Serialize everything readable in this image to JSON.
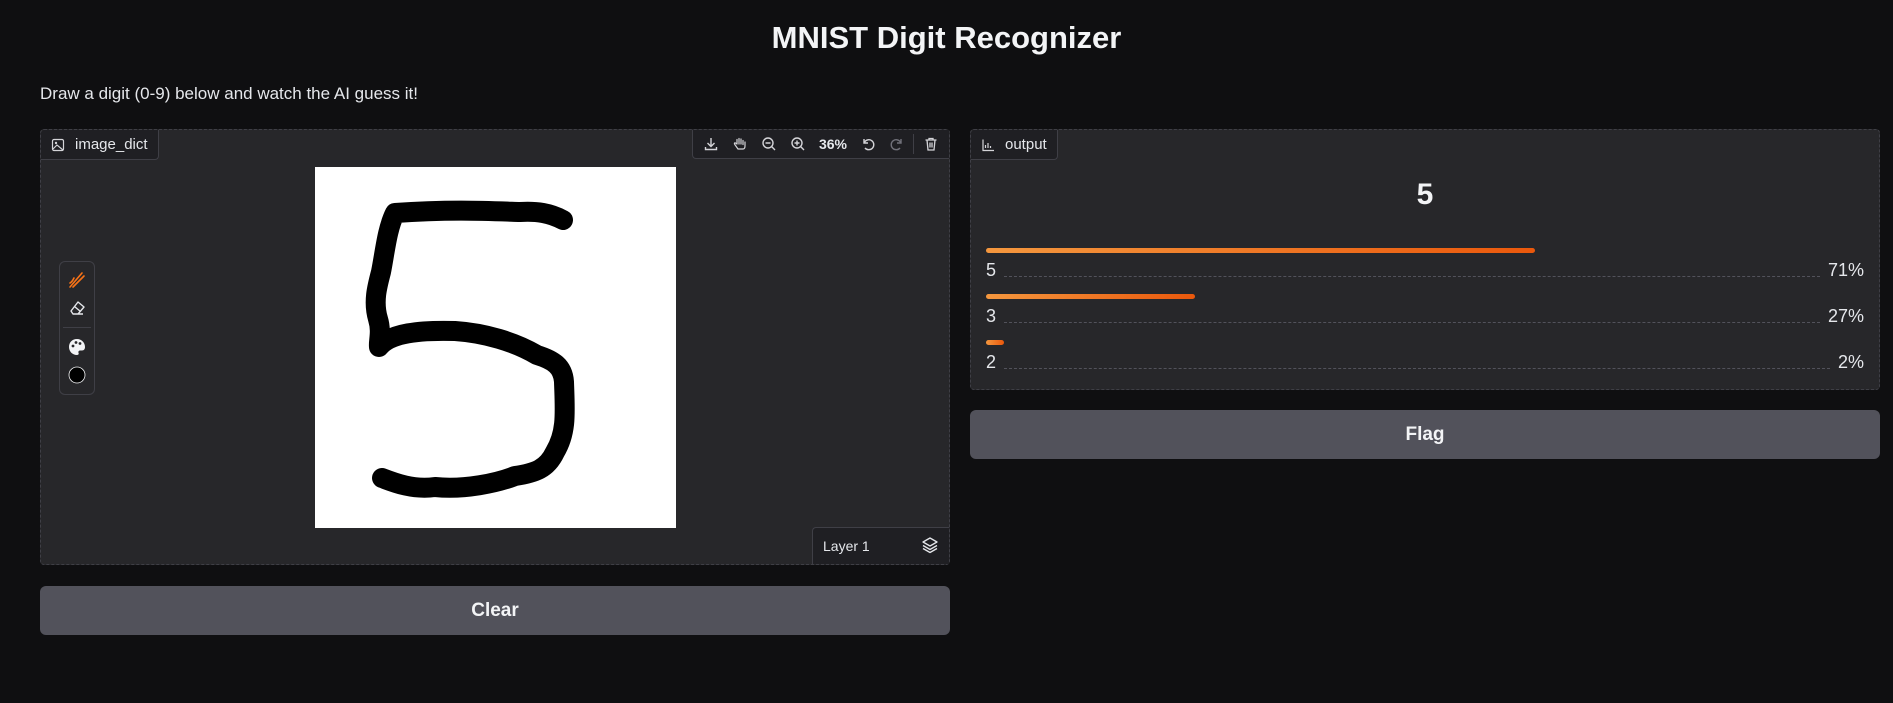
{
  "app": {
    "title": "MNIST Digit Recognizer",
    "description": "Draw a digit (0-9) below and watch the AI guess it!"
  },
  "input_panel": {
    "label": "image_dict",
    "zoom": "36%",
    "toolbar_icons": [
      "download-icon",
      "pan-hand-icon",
      "zoom-out-icon",
      "zoom-in-icon",
      "undo-icon",
      "redo-icon",
      "trash-icon"
    ],
    "tools": [
      "brush-icon",
      "eraser-icon",
      "palette-icon",
      "brush-size-icon"
    ],
    "layer_label": "Layer 1",
    "accent_color": "#f97316"
  },
  "output_panel": {
    "label": "output",
    "prediction": "5",
    "confidences": [
      {
        "label": "5",
        "value": "71%",
        "fraction": 0.71
      },
      {
        "label": "3",
        "value": "27%",
        "fraction": 0.27
      },
      {
        "label": "2",
        "value": "2%",
        "fraction": 0.02
      }
    ]
  },
  "buttons": {
    "clear": "Clear",
    "flag": "Flag"
  },
  "colors": {
    "background": "#0f0f11",
    "panel": "#27272a",
    "button": "#52525b",
    "bar": "#ea580c"
  }
}
